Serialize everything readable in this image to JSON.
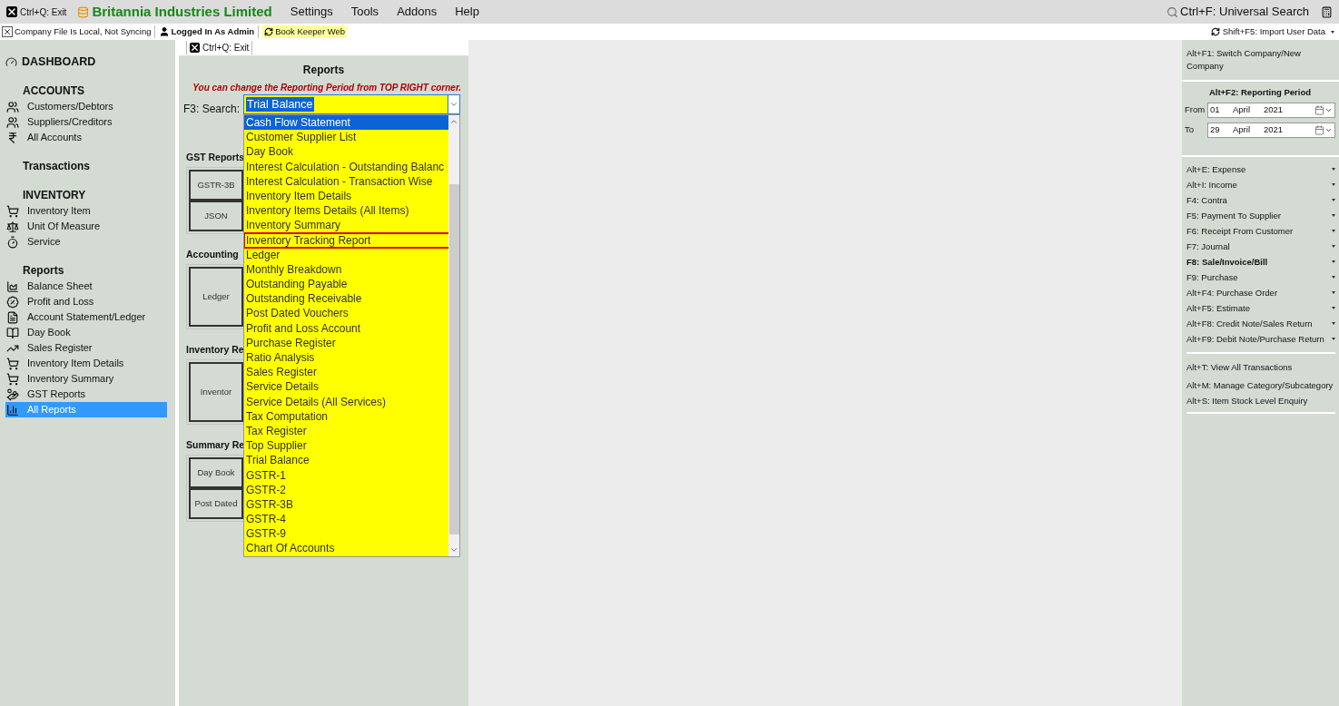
{
  "title_bar": {
    "exit": "Ctrl+Q: Exit",
    "company": "Britannia Industries Limited",
    "menus": [
      "Settings",
      "Tools",
      "Addons",
      "Help"
    ],
    "search": "Ctrl+F: Universal Search"
  },
  "status_bar": {
    "sync": "Company File Is Local, Not Syncing",
    "user": "Logged In As Admin",
    "web": "Book Keeper Web",
    "import": "Shift+F5: Import User Data"
  },
  "sidebar": {
    "dashboard": "DASHBOARD",
    "sections": [
      {
        "title": "ACCOUNTS",
        "items": [
          {
            "label": "Customers/Debtors",
            "selected": false
          },
          {
            "label": "Suppliers/Creditors",
            "selected": false
          },
          {
            "label": "All Accounts",
            "selected": false
          }
        ]
      },
      {
        "title": "Transactions"
      },
      {
        "title": "INVENTORY",
        "items": [
          {
            "label": "Inventory Item",
            "selected": false
          },
          {
            "label": "Unit Of Measure",
            "selected": false
          },
          {
            "label": "Service",
            "selected": false
          }
        ]
      },
      {
        "title": "Reports",
        "items": [
          {
            "label": "Balance Sheet",
            "selected": false
          },
          {
            "label": "Profit and Loss",
            "selected": false
          },
          {
            "label": "Account Statement/Ledger",
            "selected": false
          },
          {
            "label": "Day Book",
            "selected": false
          },
          {
            "label": "Sales Register",
            "selected": false
          },
          {
            "label": "Inventory Item Details",
            "selected": false
          },
          {
            "label": "Inventory Summary",
            "selected": false
          },
          {
            "label": "GST Reports",
            "selected": false
          },
          {
            "label": "All Reports",
            "selected": true
          }
        ]
      }
    ]
  },
  "reports_panel": {
    "exit": "Ctrl+Q: Exit",
    "title": "Reports",
    "note": "You can change the Reporting Period from TOP RIGHT corner.",
    "search_label": "F3: Search:",
    "search_value": "Trial Balance",
    "groups": [
      {
        "title": "GST Reports",
        "buttons": [
          "GSTR-3B",
          "JSON"
        ]
      },
      {
        "title": "Accounting",
        "buttons": [
          "Ledger"
        ]
      },
      {
        "title": "Inventory Re",
        "buttons": [
          "Inventor"
        ]
      },
      {
        "title": "Summary Re",
        "buttons": [
          "Day Book",
          "Post Dated"
        ]
      }
    ],
    "options": [
      {
        "label": "Cash Flow Statement",
        "selected": true,
        "outlined": false
      },
      {
        "label": "Customer Supplier List",
        "selected": false,
        "outlined": false
      },
      {
        "label": "Day Book",
        "selected": false,
        "outlined": false
      },
      {
        "label": "Interest Calculation - Outstanding Balanc",
        "selected": false,
        "outlined": false
      },
      {
        "label": "Interest Calculation - Transaction Wise",
        "selected": false,
        "outlined": false
      },
      {
        "label": "Inventory Item Details",
        "selected": false,
        "outlined": false
      },
      {
        "label": "Inventory Items Details (All Items)",
        "selected": false,
        "outlined": false
      },
      {
        "label": "Inventory Summary",
        "selected": false,
        "outlined": false
      },
      {
        "label": "Inventory Tracking Report",
        "selected": false,
        "outlined": true
      },
      {
        "label": "Ledger",
        "selected": false,
        "outlined": false
      },
      {
        "label": "Monthly Breakdown",
        "selected": false,
        "outlined": false
      },
      {
        "label": "Outstanding Payable",
        "selected": false,
        "outlined": false
      },
      {
        "label": "Outstanding Receivable",
        "selected": false,
        "outlined": false
      },
      {
        "label": "Post Dated Vouchers",
        "selected": false,
        "outlined": false
      },
      {
        "label": "Profit and Loss Account",
        "selected": false,
        "outlined": false
      },
      {
        "label": "Purchase Register",
        "selected": false,
        "outlined": false
      },
      {
        "label": "Ratio Analysis",
        "selected": false,
        "outlined": false
      },
      {
        "label": "Sales Register",
        "selected": false,
        "outlined": false
      },
      {
        "label": "Service Details",
        "selected": false,
        "outlined": false
      },
      {
        "label": "Service Details (All Services)",
        "selected": false,
        "outlined": false
      },
      {
        "label": "Tax Computation",
        "selected": false,
        "outlined": false
      },
      {
        "label": "Tax Register",
        "selected": false,
        "outlined": false
      },
      {
        "label": "Top Supplier",
        "selected": false,
        "outlined": false
      },
      {
        "label": "Trial Balance",
        "selected": false,
        "outlined": false
      },
      {
        "label": "GSTR-1",
        "selected": false,
        "outlined": false
      },
      {
        "label": "GSTR-2",
        "selected": false,
        "outlined": false
      },
      {
        "label": "GSTR-3B",
        "selected": false,
        "outlined": false
      },
      {
        "label": "GSTR-4",
        "selected": false,
        "outlined": false
      },
      {
        "label": "GSTR-9",
        "selected": false,
        "outlined": false
      },
      {
        "label": "Chart Of Accounts",
        "selected": false,
        "outlined": false
      }
    ]
  },
  "right_panel": {
    "switch_company": "Alt+F1: Switch Company/New Company",
    "period_title": "Alt+F2: Reporting Period",
    "periods": [
      {
        "label": "From",
        "day": "01",
        "month": "April",
        "year": "2021"
      },
      {
        "label": "To",
        "day": "29",
        "month": "April",
        "year": "2021"
      }
    ],
    "actions": [
      {
        "label": "Alt+E: Expense",
        "bold": false
      },
      {
        "label": "Alt+I: Income",
        "bold": false
      },
      {
        "label": "F4: Contra",
        "bold": false
      },
      {
        "label": "F5: Payment To Supplier",
        "bold": false
      },
      {
        "label": "F6: Receipt From Customer",
        "bold": false
      },
      {
        "label": "F7: Journal",
        "bold": false
      },
      {
        "label": "F8: Sale/Invoice/Bill",
        "bold": true
      },
      {
        "label": "F9: Purchase",
        "bold": false
      },
      {
        "label": "Alt+F4: Purchase Order",
        "bold": false
      },
      {
        "label": "Alt+F5: Estimate",
        "bold": false
      },
      {
        "label": "Alt+F8: Credit Note/Sales Return",
        "bold": false
      },
      {
        "label": "Alt+F9: Debit Note/Purchase Return",
        "bold": false
      }
    ],
    "links": [
      "Alt+T: View All Transactions",
      "Alt+M: Manage Category/Subcategory",
      "Alt+S: Item Stock Level Enquiry"
    ]
  }
}
